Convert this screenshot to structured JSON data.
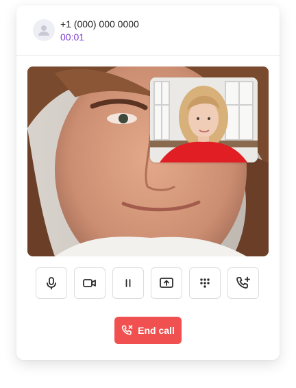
{
  "caller": {
    "phone_number": "+1 (000) 000 0000",
    "call_duration": "00:01",
    "avatar_icon": "user-icon"
  },
  "video": {
    "remote_feed": "remote-participant-video",
    "local_feed": "local-camera-preview"
  },
  "controls": [
    {
      "name": "microphone-button",
      "icon": "microphone-icon"
    },
    {
      "name": "camera-button",
      "icon": "video-camera-icon"
    },
    {
      "name": "hold-button",
      "icon": "pause-icon"
    },
    {
      "name": "share-screen-button",
      "icon": "screen-share-icon"
    },
    {
      "name": "dialpad-button",
      "icon": "dialpad-icon"
    },
    {
      "name": "add-call-button",
      "icon": "phone-plus-icon"
    }
  ],
  "end_call": {
    "label": "End call",
    "icon": "phone-hangup-icon",
    "color": "#f0504f"
  },
  "colors": {
    "accent": "#7a3bd6",
    "danger": "#f0504f",
    "icon": "#2b2b2b"
  }
}
